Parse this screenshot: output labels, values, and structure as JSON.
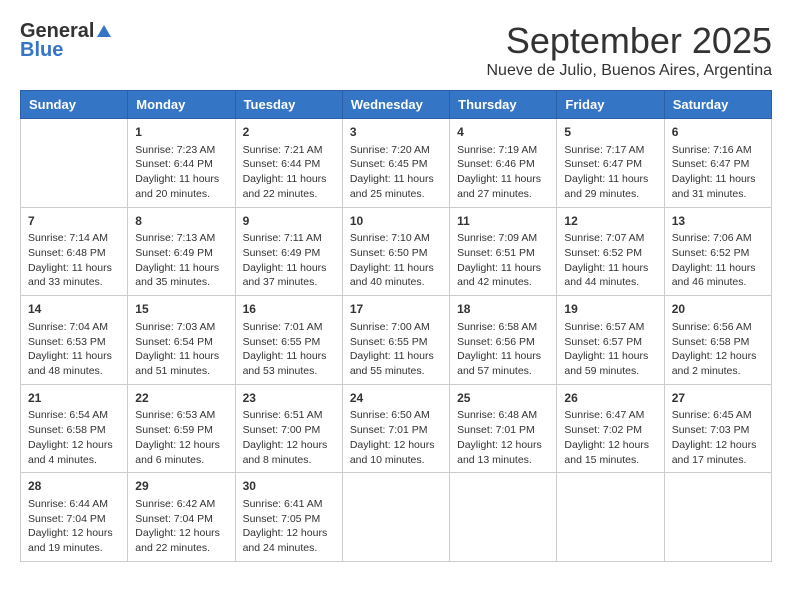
{
  "logo": {
    "general": "General",
    "blue": "Blue"
  },
  "title": "September 2025",
  "subtitle": "Nueve de Julio, Buenos Aires, Argentina",
  "days_of_week": [
    "Sunday",
    "Monday",
    "Tuesday",
    "Wednesday",
    "Thursday",
    "Friday",
    "Saturday"
  ],
  "weeks": [
    [
      {
        "day": "",
        "info": ""
      },
      {
        "day": "1",
        "info": "Sunrise: 7:23 AM\nSunset: 6:44 PM\nDaylight: 11 hours\nand 20 minutes."
      },
      {
        "day": "2",
        "info": "Sunrise: 7:21 AM\nSunset: 6:44 PM\nDaylight: 11 hours\nand 22 minutes."
      },
      {
        "day": "3",
        "info": "Sunrise: 7:20 AM\nSunset: 6:45 PM\nDaylight: 11 hours\nand 25 minutes."
      },
      {
        "day": "4",
        "info": "Sunrise: 7:19 AM\nSunset: 6:46 PM\nDaylight: 11 hours\nand 27 minutes."
      },
      {
        "day": "5",
        "info": "Sunrise: 7:17 AM\nSunset: 6:47 PM\nDaylight: 11 hours\nand 29 minutes."
      },
      {
        "day": "6",
        "info": "Sunrise: 7:16 AM\nSunset: 6:47 PM\nDaylight: 11 hours\nand 31 minutes."
      }
    ],
    [
      {
        "day": "7",
        "info": "Sunrise: 7:14 AM\nSunset: 6:48 PM\nDaylight: 11 hours\nand 33 minutes."
      },
      {
        "day": "8",
        "info": "Sunrise: 7:13 AM\nSunset: 6:49 PM\nDaylight: 11 hours\nand 35 minutes."
      },
      {
        "day": "9",
        "info": "Sunrise: 7:11 AM\nSunset: 6:49 PM\nDaylight: 11 hours\nand 37 minutes."
      },
      {
        "day": "10",
        "info": "Sunrise: 7:10 AM\nSunset: 6:50 PM\nDaylight: 11 hours\nand 40 minutes."
      },
      {
        "day": "11",
        "info": "Sunrise: 7:09 AM\nSunset: 6:51 PM\nDaylight: 11 hours\nand 42 minutes."
      },
      {
        "day": "12",
        "info": "Sunrise: 7:07 AM\nSunset: 6:52 PM\nDaylight: 11 hours\nand 44 minutes."
      },
      {
        "day": "13",
        "info": "Sunrise: 7:06 AM\nSunset: 6:52 PM\nDaylight: 11 hours\nand 46 minutes."
      }
    ],
    [
      {
        "day": "14",
        "info": "Sunrise: 7:04 AM\nSunset: 6:53 PM\nDaylight: 11 hours\nand 48 minutes."
      },
      {
        "day": "15",
        "info": "Sunrise: 7:03 AM\nSunset: 6:54 PM\nDaylight: 11 hours\nand 51 minutes."
      },
      {
        "day": "16",
        "info": "Sunrise: 7:01 AM\nSunset: 6:55 PM\nDaylight: 11 hours\nand 53 minutes."
      },
      {
        "day": "17",
        "info": "Sunrise: 7:00 AM\nSunset: 6:55 PM\nDaylight: 11 hours\nand 55 minutes."
      },
      {
        "day": "18",
        "info": "Sunrise: 6:58 AM\nSunset: 6:56 PM\nDaylight: 11 hours\nand 57 minutes."
      },
      {
        "day": "19",
        "info": "Sunrise: 6:57 AM\nSunset: 6:57 PM\nDaylight: 11 hours\nand 59 minutes."
      },
      {
        "day": "20",
        "info": "Sunrise: 6:56 AM\nSunset: 6:58 PM\nDaylight: 12 hours\nand 2 minutes."
      }
    ],
    [
      {
        "day": "21",
        "info": "Sunrise: 6:54 AM\nSunset: 6:58 PM\nDaylight: 12 hours\nand 4 minutes."
      },
      {
        "day": "22",
        "info": "Sunrise: 6:53 AM\nSunset: 6:59 PM\nDaylight: 12 hours\nand 6 minutes."
      },
      {
        "day": "23",
        "info": "Sunrise: 6:51 AM\nSunset: 7:00 PM\nDaylight: 12 hours\nand 8 minutes."
      },
      {
        "day": "24",
        "info": "Sunrise: 6:50 AM\nSunset: 7:01 PM\nDaylight: 12 hours\nand 10 minutes."
      },
      {
        "day": "25",
        "info": "Sunrise: 6:48 AM\nSunset: 7:01 PM\nDaylight: 12 hours\nand 13 minutes."
      },
      {
        "day": "26",
        "info": "Sunrise: 6:47 AM\nSunset: 7:02 PM\nDaylight: 12 hours\nand 15 minutes."
      },
      {
        "day": "27",
        "info": "Sunrise: 6:45 AM\nSunset: 7:03 PM\nDaylight: 12 hours\nand 17 minutes."
      }
    ],
    [
      {
        "day": "28",
        "info": "Sunrise: 6:44 AM\nSunset: 7:04 PM\nDaylight: 12 hours\nand 19 minutes."
      },
      {
        "day": "29",
        "info": "Sunrise: 6:42 AM\nSunset: 7:04 PM\nDaylight: 12 hours\nand 22 minutes."
      },
      {
        "day": "30",
        "info": "Sunrise: 6:41 AM\nSunset: 7:05 PM\nDaylight: 12 hours\nand 24 minutes."
      },
      {
        "day": "",
        "info": ""
      },
      {
        "day": "",
        "info": ""
      },
      {
        "day": "",
        "info": ""
      },
      {
        "day": "",
        "info": ""
      }
    ]
  ]
}
